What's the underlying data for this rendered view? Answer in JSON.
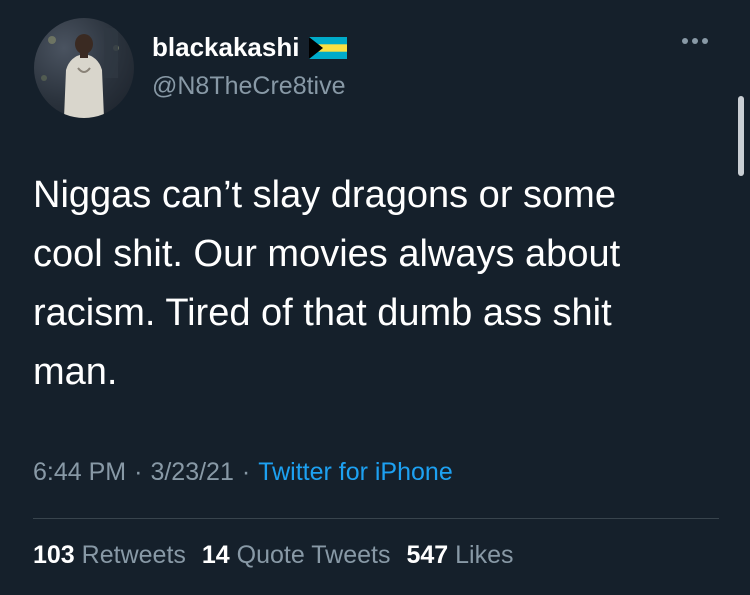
{
  "user": {
    "display_name": "blackakashi",
    "handle": "@N8TheCre8tive",
    "flag_icon": "bahamas-flag-icon"
  },
  "tweet": {
    "text_lines": [
      "Niggas can’t slay dragons or some",
      "cool shit. Our movies always about",
      "racism. Tired of that dumb ass shit",
      "man."
    ],
    "time": "6:44 PM",
    "date": "3/23/21",
    "separator": "·",
    "source": "Twitter for iPhone"
  },
  "stats": {
    "retweets_count": "103",
    "retweets_label": "Retweets",
    "quotes_count": "14",
    "quotes_label": "Quote Tweets",
    "likes_count": "547",
    "likes_label": "Likes"
  },
  "colors": {
    "background": "#15202b",
    "text_primary": "#ffffff",
    "text_secondary": "#8899a6",
    "link": "#1da1f2",
    "divider": "#38444d"
  }
}
